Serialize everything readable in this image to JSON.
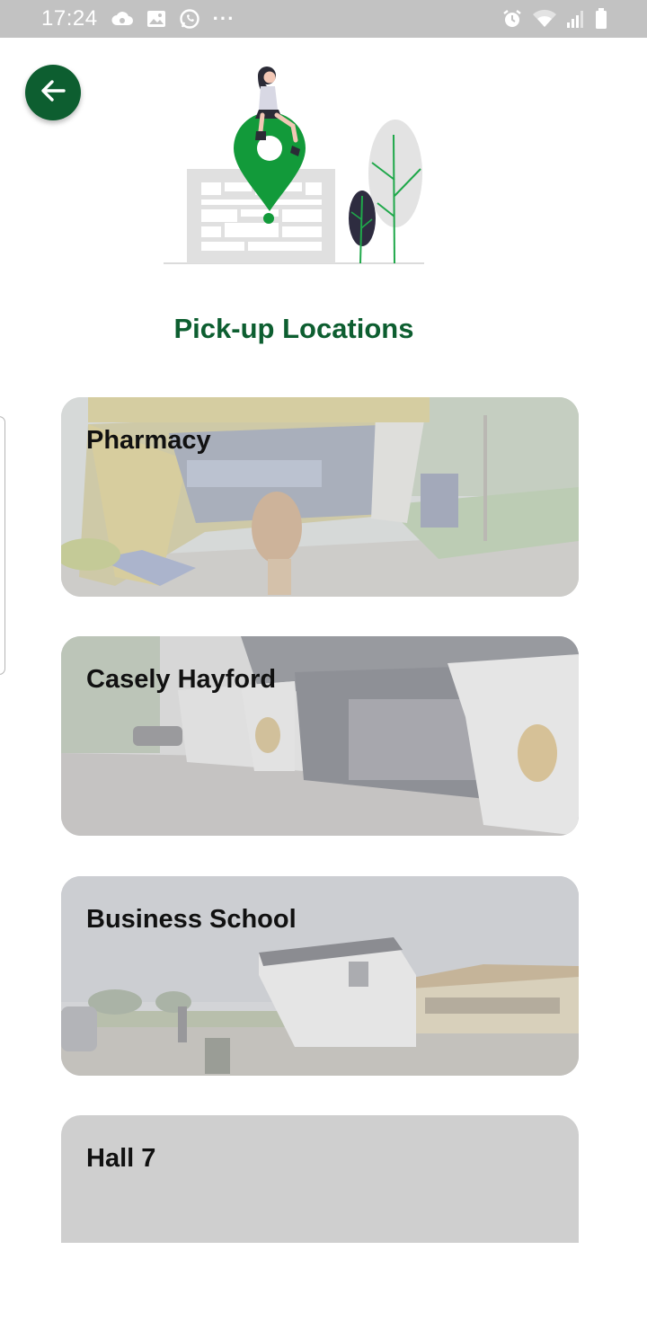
{
  "status_bar": {
    "time": "17:24",
    "left_icons": [
      "cloud-icon",
      "gallery-icon",
      "whatsapp-icon"
    ],
    "more_indicator": "···",
    "right_icons": [
      "alarm-icon",
      "wifi-icon",
      "signal-icon",
      "battery-icon"
    ]
  },
  "header": {
    "back_icon": "arrow-left-icon",
    "title": "Pick-up Locations"
  },
  "colors": {
    "brand_green": "#0d5e30",
    "pin_green": "#129a3a",
    "status_bar": "#c2c2c2"
  },
  "locations": [
    {
      "label": "Pharmacy"
    },
    {
      "label": "Casely Hayford"
    },
    {
      "label": "Business School"
    },
    {
      "label": "Hall 7"
    }
  ]
}
